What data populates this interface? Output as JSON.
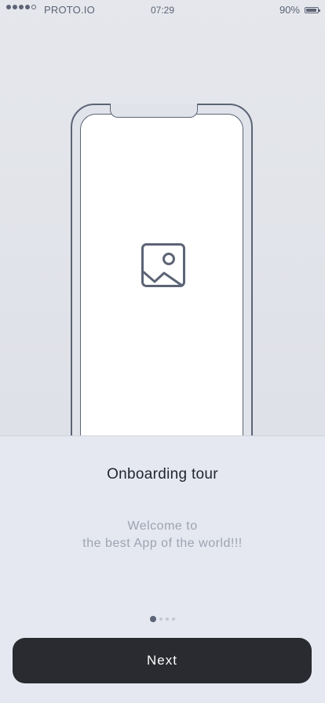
{
  "status_bar": {
    "carrier": "PROTO.IO",
    "time": "07:29",
    "battery_text": "90%",
    "battery_level": 0.9,
    "signal_bars_filled": 4,
    "signal_bars_total": 5
  },
  "mockup": {
    "image_icon": "image-placeholder-icon"
  },
  "onboarding": {
    "title": "Onboarding tour",
    "subtitle_line1": "Welcome to",
    "subtitle_line2": "the best App of the world!!!"
  },
  "pager": {
    "current_page": 1,
    "total_pages": 4
  },
  "actions": {
    "next_label": "Next"
  },
  "colors": {
    "accent": "#5c6475",
    "button_bg": "#2a2b30",
    "button_text": "#ffffff",
    "panel_bg": "#e5e8f0",
    "subtitle": "#9ea3b2"
  }
}
